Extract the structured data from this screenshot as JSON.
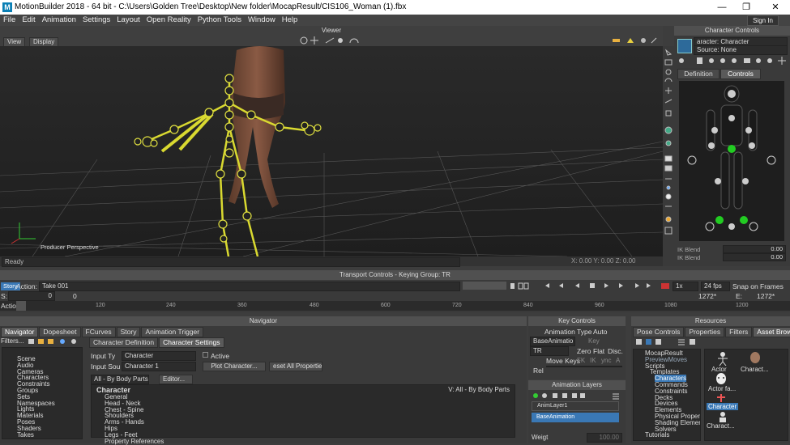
{
  "window": {
    "title": "MotionBuilder 2018 - 64 bit - C:\\Users\\Golden Tree\\Desktop\\New folder\\MocapResult/CIS106_Woman (1).fbx",
    "logo_letter": "M",
    "controls": [
      "—",
      "❐",
      "✕"
    ]
  },
  "menu": [
    "File",
    "Edit",
    "Animation",
    "Settings",
    "Layout",
    "Open Reality",
    "Python Tools",
    "Window",
    "Help"
  ],
  "sign_in": "Sign In",
  "viewer": {
    "title": "Viewer",
    "view_btn": "View",
    "display_btn": "Display",
    "camera_label": "Producer Perspective",
    "status": "Ready",
    "coords": "X: 0.00  Y: 0.00  Z: 0.00"
  },
  "character_controls": {
    "title": "Character Controls",
    "character_label": "aracter: Character",
    "source_label": "Source: None",
    "tabs": [
      "Definition",
      "Controls"
    ],
    "ik_blend_1": "IK Blend",
    "ik_blend_2": "IK Blend",
    "value_1": "0.00",
    "value_2": "0.00"
  },
  "transport": {
    "title": "Transport Controls  -  Keying Group: TR",
    "story_btn": "Story",
    "action_label": "Action:",
    "take": "Take 001",
    "speed": "1x",
    "fps": "24 fps",
    "snap": "Snap on Frames",
    "s_label": "S:",
    "s_value": "0",
    "start_value": "0",
    "end_frame": "1272*",
    "e_label": "E:",
    "e_value": "1272*",
    "action_row": "Actio",
    "ticks": [
      "120",
      "240",
      "360",
      "480",
      "600",
      "720",
      "840",
      "960",
      "1080",
      "1200"
    ]
  },
  "navigator": {
    "title": "Navigator",
    "tabs": [
      "Navigator",
      "Dopesheet",
      "FCurves",
      "Story",
      "Animation Trigger"
    ],
    "filters": "Filters...",
    "tree": [
      "Scene",
      "Audio",
      "Cameras",
      "Characters",
      "Constraints",
      "Groups",
      "Sets",
      "Namespaces",
      "Lights",
      "Materials",
      "Poses",
      "Shaders",
      "Takes"
    ],
    "sub_tabs": [
      "Character Definition",
      "Character Settings"
    ],
    "input_type_label": "Input Ty",
    "input_type_value": "Character",
    "active_label": "Active",
    "input_source_label": "Input Sou",
    "input_source_value": "Character 1",
    "plot_btn": "Plot Character...",
    "reset_btn": "eset All Propertie",
    "body_parts": "All - By Body Parts",
    "editor_btn": "Editor...",
    "char_header": "Character",
    "char_right": "V: All - By Body Parts",
    "char_items": [
      "General",
      "Head - Neck",
      "Chest - Spine",
      "Shoulders",
      "Arms - Hands",
      "Hips",
      "Legs - Feet",
      "Property References"
    ]
  },
  "key_controls": {
    "title": "Key Controls",
    "animation": "Animation",
    "type": "Type",
    "auto": "Auto",
    "base_anim": "BaseAnimatio",
    "key": "Key",
    "tr": "TR",
    "zero": "Zero",
    "flat": "Flat",
    "disc": "Disc.",
    "move_keys": "Move Keys",
    "fk": "FK",
    "ik": "IK",
    "sync": "ync",
    "a": "A",
    "rel": "Rel"
  },
  "anim_layers": {
    "title": "Animation Layers",
    "layers": [
      "AnimLayer1",
      "BaseAnimation"
    ],
    "weight_label": "Weigt",
    "weight_value": "100.00"
  },
  "resources": {
    "title": "Resources",
    "tabs": [
      "Pose Controls",
      "Properties",
      "Filters",
      "Asset Browser"
    ],
    "tree": [
      "MocapResult",
      "PreviewMoves",
      "Scripts",
      "Templates",
      "Characters",
      "Commands",
      "Constraints",
      "Decks",
      "Devices",
      "Elements",
      "Physical Propert",
      "Shading Elemer",
      "Solvers",
      "Tutorials"
    ],
    "selected": "Characters",
    "assets": [
      "Actor",
      "Charact...",
      "Actor fa...",
      "Character",
      "Charact..."
    ]
  }
}
